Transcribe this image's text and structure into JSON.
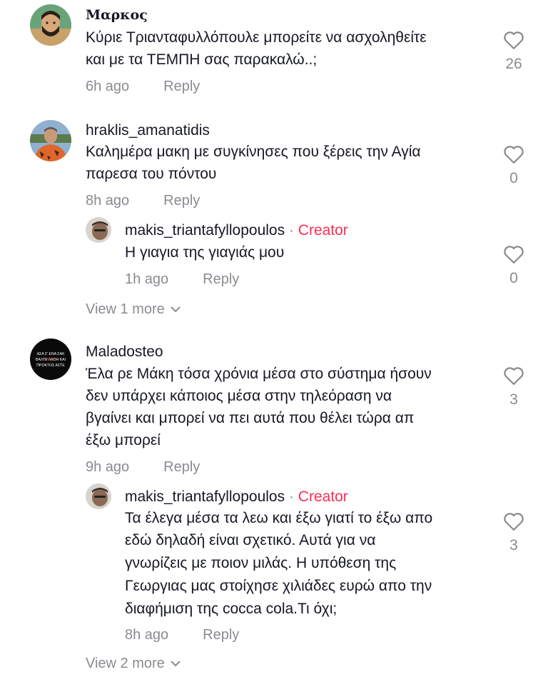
{
  "comments": [
    {
      "username": "Μαρκος",
      "lines": [
        "Κύριε Τριανταφυλλόπουλε μπορείτε να ασχοληθείτε",
        "και με τα ΤΕΜΠΗ σας παρακαλώ..;"
      ],
      "time": "6h ago",
      "reply_label": "Reply",
      "likes": "26",
      "avatar_icon": "avatar-bearded-man-illustration"
    },
    {
      "username": "hraklis_amanatidis",
      "lines": [
        "Καλημέρα μακη με συγκίνησες που ξέρεις την Αγία",
        "παρεσα του πόντου"
      ],
      "time": "8h ago",
      "reply_label": "Reply",
      "likes": "0",
      "avatar_icon": "avatar-man-outdoors-photo",
      "replies": [
        {
          "username": "makis_triantafyllopoulos",
          "separator": " · ",
          "badge": "Creator",
          "lines": [
            "Η γιαγια της γιαγιάς μου"
          ],
          "time": "1h ago",
          "reply_label": "Reply",
          "likes": "0",
          "avatar_icon": "avatar-man-photo"
        }
      ],
      "view_more": "View 1 more"
    },
    {
      "username": "Maladosteo",
      "lines": [
        "Έλα ρε Μάκη τόσα χρόνια μέσα στο σύστημα ήσουν",
        "δεν υπάρχει κάποιος μέσα στην τηλεόραση να",
        "βγαίνει και μπορεί να πει αυτά που θέλει τώρα απ",
        "έξω μπορεί"
      ],
      "time": "9h ago",
      "reply_label": "Reply",
      "likes": "3",
      "avatar_icon": "avatar-black-text-badge",
      "avatar_text": [
        "ΑΣΑ Σ' ΕΝΑ ΣΑΚ",
        "ΒΑΛΤΕ ΛΑΘΗ ΚΑΙ",
        "ΠΡΟΚΤΟΣ ΑΣΤΕ"
      ],
      "replies": [
        {
          "username": "makis_triantafyllopoulos",
          "separator": " · ",
          "badge": "Creator",
          "lines": [
            "Τα έλεγα μέσα τα λεω και έξω γιατί το έξω απο",
            "εδώ δηλαδή είναι σχετικό. Αυτά για να",
            "γνωρίζεις με ποιον μιλάς. Η υπόθεση της",
            "Γεωργιας μας στοίχησε χιλιάδες ευρώ απο την",
            "διαφήμιση της cocca cola.Τι όχι;"
          ],
          "time": "8h ago",
          "reply_label": "Reply",
          "likes": "3",
          "avatar_icon": "avatar-man-photo"
        }
      ],
      "view_more": "View 2 more"
    }
  ],
  "colors": {
    "text": "#161823",
    "muted": "#8a8b91",
    "creator": "#fe2c55"
  },
  "icons": {
    "like": "heart-outline-icon",
    "expand": "chevron-down-icon"
  }
}
